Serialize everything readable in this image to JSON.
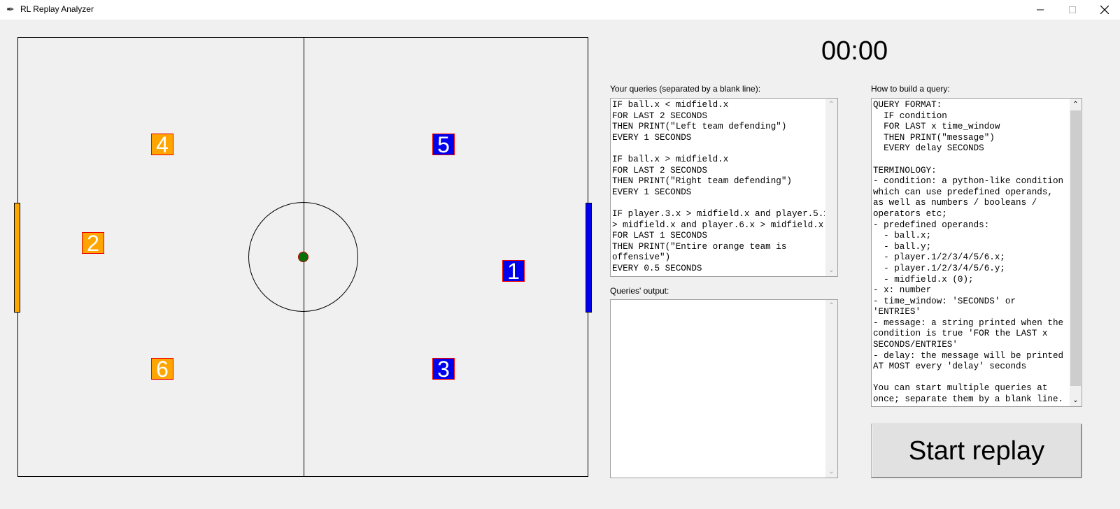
{
  "window": {
    "title": "RL Replay Analyzer",
    "minimize": "minimize",
    "maximize": "maximize",
    "close": "close"
  },
  "field": {
    "players": [
      {
        "number": "4",
        "team": "orange"
      },
      {
        "number": "2",
        "team": "orange"
      },
      {
        "number": "6",
        "team": "orange"
      },
      {
        "number": "5",
        "team": "blue"
      },
      {
        "number": "1",
        "team": "blue"
      },
      {
        "number": "3",
        "team": "blue"
      }
    ],
    "colors": {
      "orange_team": "#ffa500",
      "blue_team": "#0000ee",
      "ball": "#0a6e0a"
    }
  },
  "timer": "00:00",
  "queries": {
    "label": "Your queries (separated by a blank line):",
    "text": "IF ball.x < midfield.x\nFOR LAST 2 SECONDS\nTHEN PRINT(\"Left team defending\")\nEVERY 1 SECONDS\n\nIF ball.x > midfield.x\nFOR LAST 2 SECONDS\nTHEN PRINT(\"Right team defending\")\nEVERY 1 SECONDS\n\nIF player.3.x > midfield.x and player.5.x\n> midfield.x and player.6.x > midfield.x\nFOR LAST 1 SECONDS\nTHEN PRINT(\"Entire orange team is\noffensive\")\nEVERY 0.5 SECONDS"
  },
  "output": {
    "label": "Queries' output:",
    "text": ""
  },
  "help": {
    "label": "How to build a query:",
    "text": "QUERY FORMAT:\n  IF condition\n  FOR LAST x time_window\n  THEN PRINT(\"message\")\n  EVERY delay SECONDS\n\nTERMINOLOGY:\n- condition: a python-like condition\nwhich can use predefined operands,\nas well as numbers / booleans /\noperators etc;\n- predefined operands:\n  - ball.x;\n  - ball.y;\n  - player.1/2/3/4/5/6.x;\n  - player.1/2/3/4/5/6.y;\n  - midfield.x (0);\n- x: number\n- time_window: 'SECONDS' or\n'ENTRIES'\n- message: a string printed when the\ncondition is true 'FOR the LAST x\nSECONDS/ENTRIES'\n- delay: the message will be printed\nAT MOST every 'delay' seconds\n\nYou can start multiple queries at\nonce; separate them by a blank line."
  },
  "start_button": "Start replay"
}
